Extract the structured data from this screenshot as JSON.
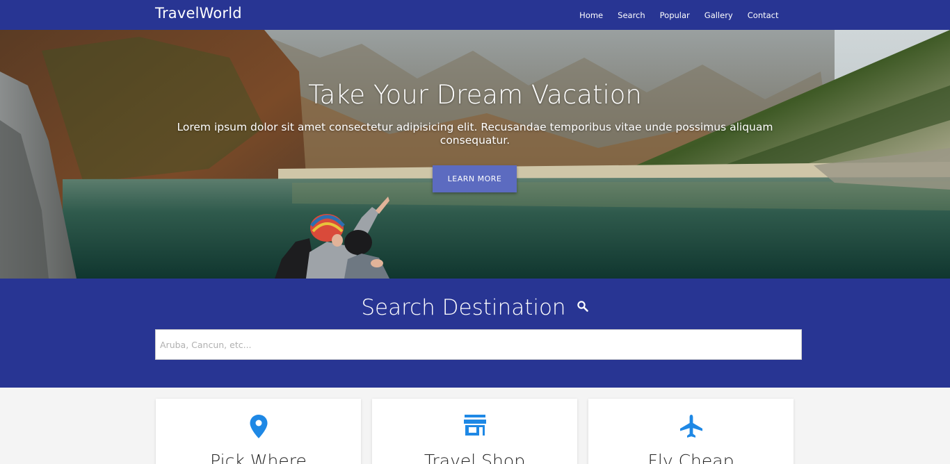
{
  "navbar": {
    "brand": "TravelWorld",
    "links": [
      "Home",
      "Search",
      "Popular",
      "Gallery",
      "Contact"
    ]
  },
  "hero": {
    "title": "Take Your Dream Vacation",
    "text": "Lorem ipsum dolor sit amet consectetur adipisicing elit. Recusandae temporibus vitae unde possimus aliquam consequatur.",
    "button_label": "LEARN MORE"
  },
  "search": {
    "title": "Search Destination",
    "icon": "search-icon",
    "placeholder": "Aruba, Cancun, etc..."
  },
  "cards": [
    {
      "title": "Pick Where",
      "icon": "map-pin-icon"
    },
    {
      "title": "Travel Shop",
      "icon": "store-icon"
    },
    {
      "title": "Fly Cheap",
      "icon": "airplane-icon"
    }
  ],
  "colors": {
    "primary": "#283593",
    "button": "#5c6bc0",
    "icon_accent": "#1e88e5",
    "page_bg": "#f4f4f4"
  }
}
